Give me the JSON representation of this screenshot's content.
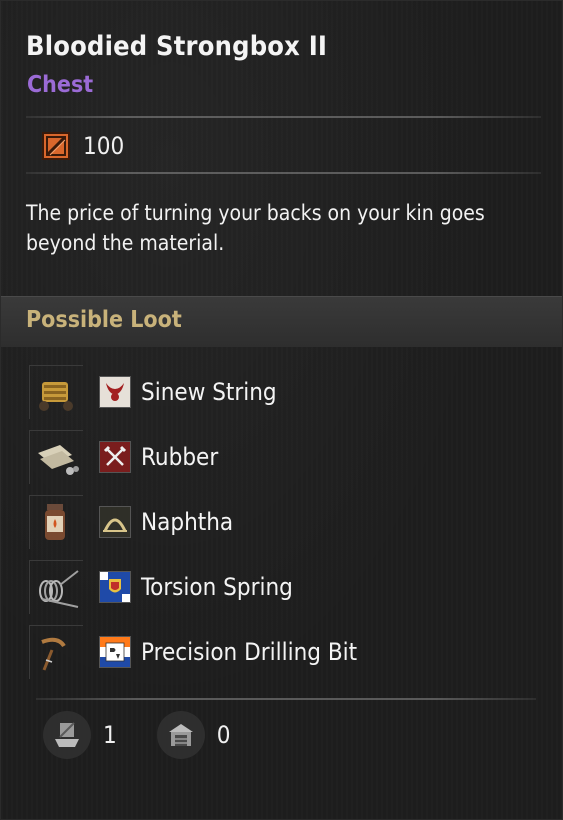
{
  "item": {
    "title": "Bloodied Strongbox II",
    "category": "Chest",
    "cost_value": "100",
    "description": "The price of turning your backs on your kin goes beyond the material."
  },
  "loot": {
    "header": "Possible Loot",
    "items": [
      {
        "name": "Sinew String",
        "thumb_icon": "sinew-string-icon",
        "badge_icon": "horned-emblem-icon"
      },
      {
        "name": "Rubber",
        "thumb_icon": "rubber-sheets-icon",
        "badge_icon": "crossed-tools-emblem-icon"
      },
      {
        "name": "Naphtha",
        "thumb_icon": "naphtha-jar-icon",
        "badge_icon": "arch-emblem-icon"
      },
      {
        "name": "Torsion Spring",
        "thumb_icon": "torsion-spring-icon",
        "badge_icon": "heraldic-crest-icon"
      },
      {
        "name": "Precision Drilling Bit",
        "thumb_icon": "drilling-bit-icon",
        "badge_icon": "dcm-flag-icon"
      }
    ]
  },
  "footer": {
    "stat1_value": "1",
    "stat1_icon": "ship-crate-icon",
    "stat2_value": "0",
    "stat2_icon": "storage-building-icon"
  },
  "colors": {
    "category": "#9b6bd6",
    "loot_header": "#c8b27a",
    "cost_icon": "#d9672c"
  }
}
